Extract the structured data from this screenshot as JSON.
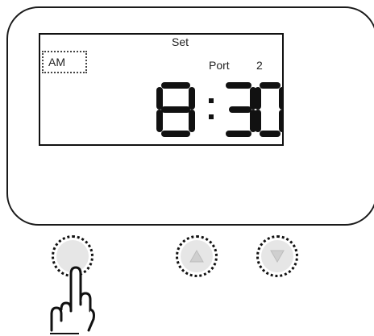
{
  "lcd": {
    "set_label": "Set",
    "am_pm": "AM",
    "port_label": "Port",
    "port_value": "2",
    "time_hour": "8",
    "time_separator": ":",
    "time_minutes": "30"
  },
  "buttons": [
    {
      "name": "set-button",
      "icon": "circle"
    },
    {
      "name": "up-button",
      "icon": "triangle-up-icon"
    },
    {
      "name": "down-button",
      "icon": "triangle-down-icon"
    }
  ],
  "colors": {
    "outline": "#111111",
    "button_fill": "#e6e6e6"
  }
}
